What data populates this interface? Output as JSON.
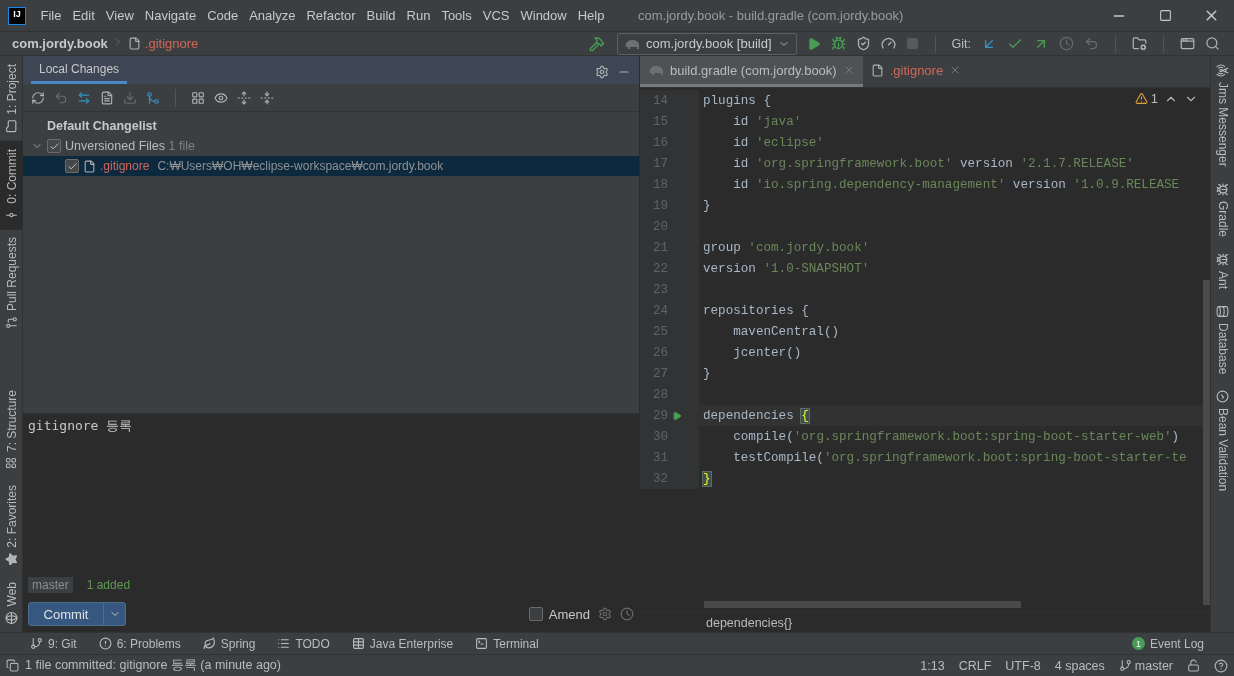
{
  "window": {
    "logo": "IJ",
    "title": "com.jordy.book - build.gradle (com.jordy.book)"
  },
  "menu": [
    "File",
    "Edit",
    "View",
    "Navigate",
    "Code",
    "Analyze",
    "Refactor",
    "Build",
    "Run",
    "Tools",
    "VCS",
    "Window",
    "Help"
  ],
  "breadcrumb": {
    "project": "com.jordy.book",
    "file": ".gitignore",
    "unversioned": true
  },
  "toolbar": {
    "run_config": "com.jordy.book [build]",
    "git_label": "Git:"
  },
  "left_stripe": {
    "top": [
      {
        "label": "1: Project",
        "selected": false
      },
      {
        "label": "0: Commit",
        "selected": true
      },
      {
        "label": "Pull Requests",
        "selected": false
      }
    ],
    "bottom": [
      {
        "label": "7: Structure",
        "selected": false
      },
      {
        "label": "2: Favorites",
        "selected": false
      },
      {
        "label": "Web",
        "selected": false
      }
    ]
  },
  "commit_panel": {
    "tab": {
      "label": "Local Changes",
      "selected": true
    },
    "changelist": "Default Changelist",
    "groups": [
      {
        "label": "Unversioned Files",
        "count": "1 file",
        "checked": true,
        "expanded": true,
        "children": [
          {
            "name": ".gitignore",
            "path": "C:₩Users₩OH₩eclipse-workspace₩com.jordy.book",
            "checked": true,
            "selected": true,
            "unversioned": true
          }
        ]
      }
    ],
    "message": "gitignore 등록",
    "branch": "master",
    "summary": "1 added",
    "commit_button": "Commit",
    "amend": {
      "label": "Amend",
      "checked": false
    }
  },
  "editor": {
    "tabs": [
      {
        "label": "build.gradle (com.jordy.book)",
        "selected": true,
        "unversioned": false
      },
      {
        "label": ".gitignore",
        "selected": false,
        "unversioned": true
      }
    ],
    "warnings": "1",
    "lines": [
      {
        "number": "14",
        "current": false,
        "runnable": false,
        "tokens": [
          {
            "kind": "plain",
            "text": "plugins {"
          }
        ]
      },
      {
        "number": "15",
        "current": false,
        "runnable": false,
        "tokens": [
          {
            "kind": "plain",
            "text": "    id "
          },
          {
            "kind": "string",
            "text": "'java'"
          }
        ]
      },
      {
        "number": "16",
        "current": false,
        "runnable": false,
        "tokens": [
          {
            "kind": "plain",
            "text": "    id "
          },
          {
            "kind": "string",
            "text": "'eclipse'"
          }
        ]
      },
      {
        "number": "17",
        "current": false,
        "runnable": false,
        "tokens": [
          {
            "kind": "plain",
            "text": "    id "
          },
          {
            "kind": "string",
            "text": "'org.springframework.boot'"
          },
          {
            "kind": "plain",
            "text": " version "
          },
          {
            "kind": "string",
            "text": "'2.1.7.RELEASE'"
          }
        ]
      },
      {
        "number": "18",
        "current": false,
        "runnable": false,
        "tokens": [
          {
            "kind": "plain",
            "text": "    id "
          },
          {
            "kind": "string",
            "text": "'io.spring.dependency-management'"
          },
          {
            "kind": "plain",
            "text": " version "
          },
          {
            "kind": "string",
            "text": "'1.0.9.RELEASE"
          }
        ]
      },
      {
        "number": "19",
        "current": false,
        "runnable": false,
        "tokens": [
          {
            "kind": "plain",
            "text": "}"
          }
        ]
      },
      {
        "number": "20",
        "current": false,
        "runnable": false
      },
      {
        "number": "21",
        "current": false,
        "runnable": false,
        "tokens": [
          {
            "kind": "plain",
            "text": "group "
          },
          {
            "kind": "string",
            "text": "'com.jordy.book'"
          }
        ]
      },
      {
        "number": "22",
        "current": false,
        "runnable": false,
        "tokens": [
          {
            "kind": "plain",
            "text": "version "
          },
          {
            "kind": "string",
            "text": "'1.0-SNAPSHOT'"
          }
        ]
      },
      {
        "number": "23",
        "current": false,
        "runnable": false
      },
      {
        "number": "24",
        "current": false,
        "runnable": false,
        "tokens": [
          {
            "kind": "plain",
            "text": "repositories {"
          }
        ]
      },
      {
        "number": "25",
        "current": false,
        "runnable": false,
        "tokens": [
          {
            "kind": "plain",
            "text": "    mavenCentral()"
          }
        ]
      },
      {
        "number": "26",
        "current": false,
        "runnable": false,
        "tokens": [
          {
            "kind": "plain",
            "text": "    jcenter()"
          }
        ]
      },
      {
        "number": "27",
        "current": false,
        "runnable": false,
        "tokens": [
          {
            "kind": "plain",
            "text": "}"
          }
        ]
      },
      {
        "number": "28",
        "current": false,
        "runnable": false
      },
      {
        "number": "29",
        "current": true,
        "runnable": true,
        "tokens": [
          {
            "kind": "plain",
            "text": "dependencies "
          },
          {
            "kind": "matched",
            "text": "{"
          }
        ]
      },
      {
        "number": "30",
        "current": false,
        "runnable": false,
        "tokens": [
          {
            "kind": "plain",
            "text": "    compile("
          },
          {
            "kind": "string",
            "text": "'org.springframework.boot:spring-boot-starter-web'"
          },
          {
            "kind": "plain",
            "text": ")"
          }
        ]
      },
      {
        "number": "31",
        "current": false,
        "runnable": false,
        "tokens": [
          {
            "kind": "plain",
            "text": "    testCompile("
          },
          {
            "kind": "string",
            "text": "'org.springframework.boot:spring-boot-starter-te"
          }
        ]
      },
      {
        "number": "32",
        "current": false,
        "runnable": false,
        "tokens": [
          {
            "kind": "matched",
            "text": "}"
          }
        ]
      }
    ],
    "breadcrumb": "dependencies{}"
  },
  "right_stripe": [
    {
      "label": "Jms Messenger"
    },
    {
      "label": "Gradle"
    },
    {
      "label": "Ant"
    },
    {
      "label": "Database"
    },
    {
      "label": "Bean Validation"
    }
  ],
  "tool_windows": [
    {
      "label": "9: Git"
    },
    {
      "label": "6: Problems"
    },
    {
      "label": "Spring"
    },
    {
      "label": "TODO"
    },
    {
      "label": "Java Enterprise"
    },
    {
      "label": "Terminal"
    }
  ],
  "event_log": {
    "label": "Event Log",
    "count": "1"
  },
  "status_bar": {
    "message": "1 file committed: gitignore 등록 (a minute ago)",
    "position": "1:13",
    "line_separator": "CRLF",
    "encoding": "UTF-8",
    "indent": "4 spaces",
    "branch": "master"
  }
}
